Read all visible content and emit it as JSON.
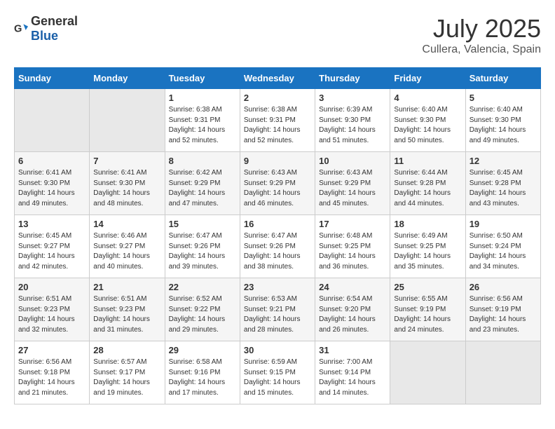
{
  "logo": {
    "general": "General",
    "blue": "Blue"
  },
  "title": {
    "month": "July 2025",
    "location": "Cullera, Valencia, Spain"
  },
  "weekdays": [
    "Sunday",
    "Monday",
    "Tuesday",
    "Wednesday",
    "Thursday",
    "Friday",
    "Saturday"
  ],
  "weeks": [
    [
      {
        "day": "",
        "empty": true
      },
      {
        "day": "",
        "empty": true
      },
      {
        "day": "1",
        "sunrise": "6:38 AM",
        "sunset": "9:31 PM",
        "daylight": "14 hours and 52 minutes."
      },
      {
        "day": "2",
        "sunrise": "6:38 AM",
        "sunset": "9:31 PM",
        "daylight": "14 hours and 52 minutes."
      },
      {
        "day": "3",
        "sunrise": "6:39 AM",
        "sunset": "9:30 PM",
        "daylight": "14 hours and 51 minutes."
      },
      {
        "day": "4",
        "sunrise": "6:40 AM",
        "sunset": "9:30 PM",
        "daylight": "14 hours and 50 minutes."
      },
      {
        "day": "5",
        "sunrise": "6:40 AM",
        "sunset": "9:30 PM",
        "daylight": "14 hours and 49 minutes."
      }
    ],
    [
      {
        "day": "6",
        "sunrise": "6:41 AM",
        "sunset": "9:30 PM",
        "daylight": "14 hours and 49 minutes."
      },
      {
        "day": "7",
        "sunrise": "6:41 AM",
        "sunset": "9:30 PM",
        "daylight": "14 hours and 48 minutes."
      },
      {
        "day": "8",
        "sunrise": "6:42 AM",
        "sunset": "9:29 PM",
        "daylight": "14 hours and 47 minutes."
      },
      {
        "day": "9",
        "sunrise": "6:43 AM",
        "sunset": "9:29 PM",
        "daylight": "14 hours and 46 minutes."
      },
      {
        "day": "10",
        "sunrise": "6:43 AM",
        "sunset": "9:29 PM",
        "daylight": "14 hours and 45 minutes."
      },
      {
        "day": "11",
        "sunrise": "6:44 AM",
        "sunset": "9:28 PM",
        "daylight": "14 hours and 44 minutes."
      },
      {
        "day": "12",
        "sunrise": "6:45 AM",
        "sunset": "9:28 PM",
        "daylight": "14 hours and 43 minutes."
      }
    ],
    [
      {
        "day": "13",
        "sunrise": "6:45 AM",
        "sunset": "9:27 PM",
        "daylight": "14 hours and 42 minutes."
      },
      {
        "day": "14",
        "sunrise": "6:46 AM",
        "sunset": "9:27 PM",
        "daylight": "14 hours and 40 minutes."
      },
      {
        "day": "15",
        "sunrise": "6:47 AM",
        "sunset": "9:26 PM",
        "daylight": "14 hours and 39 minutes."
      },
      {
        "day": "16",
        "sunrise": "6:47 AM",
        "sunset": "9:26 PM",
        "daylight": "14 hours and 38 minutes."
      },
      {
        "day": "17",
        "sunrise": "6:48 AM",
        "sunset": "9:25 PM",
        "daylight": "14 hours and 36 minutes."
      },
      {
        "day": "18",
        "sunrise": "6:49 AM",
        "sunset": "9:25 PM",
        "daylight": "14 hours and 35 minutes."
      },
      {
        "day": "19",
        "sunrise": "6:50 AM",
        "sunset": "9:24 PM",
        "daylight": "14 hours and 34 minutes."
      }
    ],
    [
      {
        "day": "20",
        "sunrise": "6:51 AM",
        "sunset": "9:23 PM",
        "daylight": "14 hours and 32 minutes."
      },
      {
        "day": "21",
        "sunrise": "6:51 AM",
        "sunset": "9:23 PM",
        "daylight": "14 hours and 31 minutes."
      },
      {
        "day": "22",
        "sunrise": "6:52 AM",
        "sunset": "9:22 PM",
        "daylight": "14 hours and 29 minutes."
      },
      {
        "day": "23",
        "sunrise": "6:53 AM",
        "sunset": "9:21 PM",
        "daylight": "14 hours and 28 minutes."
      },
      {
        "day": "24",
        "sunrise": "6:54 AM",
        "sunset": "9:20 PM",
        "daylight": "14 hours and 26 minutes."
      },
      {
        "day": "25",
        "sunrise": "6:55 AM",
        "sunset": "9:19 PM",
        "daylight": "14 hours and 24 minutes."
      },
      {
        "day": "26",
        "sunrise": "6:56 AM",
        "sunset": "9:19 PM",
        "daylight": "14 hours and 23 minutes."
      }
    ],
    [
      {
        "day": "27",
        "sunrise": "6:56 AM",
        "sunset": "9:18 PM",
        "daylight": "14 hours and 21 minutes."
      },
      {
        "day": "28",
        "sunrise": "6:57 AM",
        "sunset": "9:17 PM",
        "daylight": "14 hours and 19 minutes."
      },
      {
        "day": "29",
        "sunrise": "6:58 AM",
        "sunset": "9:16 PM",
        "daylight": "14 hours and 17 minutes."
      },
      {
        "day": "30",
        "sunrise": "6:59 AM",
        "sunset": "9:15 PM",
        "daylight": "14 hours and 15 minutes."
      },
      {
        "day": "31",
        "sunrise": "7:00 AM",
        "sunset": "9:14 PM",
        "daylight": "14 hours and 14 minutes."
      },
      {
        "day": "",
        "empty": true
      },
      {
        "day": "",
        "empty": true
      }
    ]
  ],
  "labels": {
    "sunrise": "Sunrise:",
    "sunset": "Sunset:",
    "daylight": "Daylight:"
  }
}
